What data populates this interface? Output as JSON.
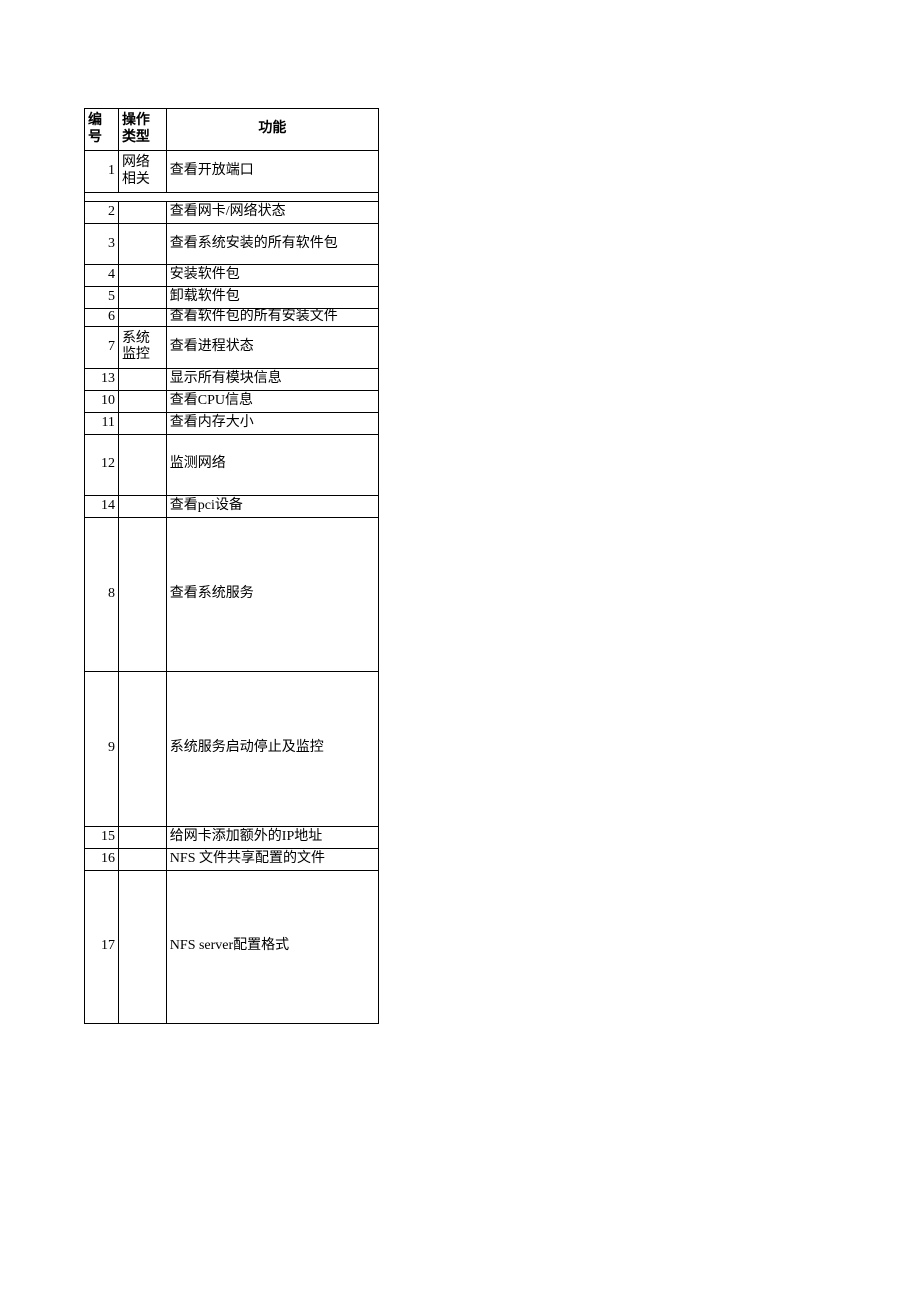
{
  "headers": {
    "col1": "编号",
    "col2": "操作类型",
    "col3": "功能"
  },
  "rows": [
    {
      "num": "1",
      "type": "网络相关",
      "func": "查看开放端口",
      "cls": "h-row1"
    },
    {
      "spacer": true,
      "cls": "h-spacer"
    },
    {
      "num": "2",
      "type": "",
      "func": "查看网卡/网络状态",
      "cls": "h-22"
    },
    {
      "num": "3",
      "type": "",
      "func": "查看系统安装的所有软件包",
      "cls": "h-41"
    },
    {
      "num": "4",
      "type": "",
      "func": "安装软件包",
      "cls": "h-22"
    },
    {
      "num": "5",
      "type": "",
      "func": "卸载软件包",
      "cls": "h-22"
    },
    {
      "num": "6",
      "type": "",
      "func": "查看软件包的所有安装文件",
      "cls": "trunc"
    },
    {
      "num": "7",
      "type": "系统监控",
      "func": "查看进程状态",
      "cls": "h-row7"
    },
    {
      "num": "13",
      "type": "",
      "func": "显示所有模块信息",
      "cls": "h-22"
    },
    {
      "num": "10",
      "type": "",
      "func": "查看CPU信息",
      "cls": "h-22"
    },
    {
      "num": "11",
      "type": "",
      "func": "查看内存大小",
      "cls": "h-22"
    },
    {
      "num": "12",
      "type": "",
      "func": "监测网络",
      "cls": "h-row12"
    },
    {
      "num": "14",
      "type": "",
      "func": "查看pci设备",
      "cls": "h-22"
    },
    {
      "num": "8",
      "type": "",
      "func": "查看系统服务",
      "cls": "h-row8"
    },
    {
      "num": "9",
      "type": "",
      "func": "系统服务启动停止及监控",
      "cls": "h-row9"
    },
    {
      "num": "15",
      "type": "",
      "func": "给网卡添加额外的IP地址",
      "cls": "h-22"
    },
    {
      "num": "16",
      "type": "",
      "func": "NFS 文件共享配置的文件",
      "cls": "h-22"
    },
    {
      "num": "17",
      "type": "",
      "func": "NFS server配置格式",
      "cls": "h-row17"
    }
  ]
}
